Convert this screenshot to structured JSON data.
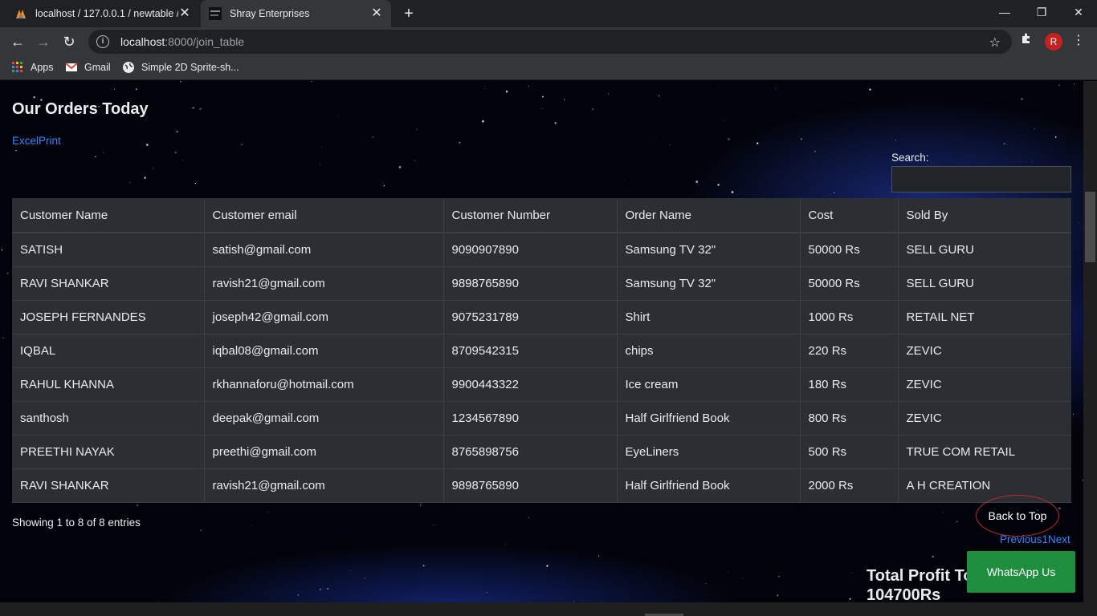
{
  "browser": {
    "tabs": [
      {
        "title": "localhost / 127.0.0.1 / newtable /",
        "active": false
      },
      {
        "title": "Shray Enterprises",
        "active": true
      }
    ],
    "url_host": "localhost",
    "url_rest": ":8000/join_table",
    "bookmarks": [
      {
        "label": "Apps",
        "icon": "apps-grid-icon"
      },
      {
        "label": "Gmail",
        "icon": "gmail-icon"
      },
      {
        "label": "Simple 2D Sprite-sh...",
        "icon": "globe-icon"
      }
    ],
    "profile_initial": "R"
  },
  "page": {
    "title": "Our Orders Today",
    "excel_link": "ExcelPrint",
    "search_label": "Search:",
    "search_value": "",
    "table": {
      "headers": [
        "Customer Name",
        "Customer email",
        "Customer Number",
        "Order Name",
        "Cost",
        "Sold By"
      ],
      "rows": [
        [
          "SATISH",
          "satish@gmail.com",
          "9090907890",
          "Samsung TV 32\"",
          "50000 Rs",
          "SELL GURU"
        ],
        [
          "RAVI SHANKAR",
          "ravish21@gmail.com",
          "9898765890",
          "Samsung TV 32\"",
          "50000 Rs",
          "SELL GURU"
        ],
        [
          "JOSEPH FERNANDES",
          "joseph42@gmail.com",
          "9075231789",
          "Shirt",
          "1000 Rs",
          "RETAIL NET"
        ],
        [
          "IQBAL",
          "iqbal08@gmail.com",
          "8709542315",
          "chips",
          "220 Rs",
          "ZEVIC"
        ],
        [
          "RAHUL KHANNA",
          "rkhannaforu@hotmail.com",
          "9900443322",
          "Ice cream",
          "180 Rs",
          "ZEVIC"
        ],
        [
          "santhosh",
          "deepak@gmail.com",
          "1234567890",
          "Half Girlfriend Book",
          "800 Rs",
          "ZEVIC"
        ],
        [
          "PREETHI NAYAK",
          "preethi@gmail.com",
          "8765898756",
          "EyeLiners",
          "500 Rs",
          "TRUE COM RETAIL"
        ],
        [
          "RAVI SHANKAR",
          "ravish21@gmail.com",
          "9898765890",
          "Half Girlfriend Book",
          "2000 Rs",
          "A H CREATION"
        ]
      ]
    },
    "info": "Showing 1 to 8 of 8 entries",
    "pager": {
      "previous": "Previous",
      "page": "1",
      "next": "Next"
    },
    "back_to_top": "Back to Top",
    "profit_line1": "Total Profit To",
    "profit_line2": "104700Rs",
    "whatsapp": "WhatsApp Us"
  },
  "colors": {
    "link": "#2f87ff",
    "whatsapp": "#1e8d3e",
    "table_bg": "#2b2f33",
    "profile": "#c5221f"
  }
}
